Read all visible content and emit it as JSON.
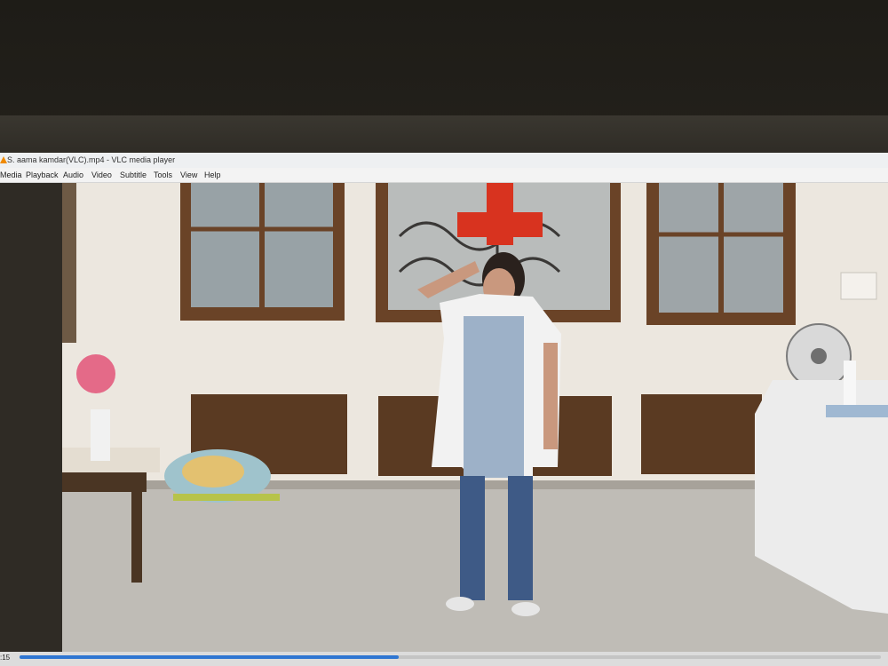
{
  "window": {
    "title": "S. aama kamdar(VLC).mp4 - VLC media player"
  },
  "menu": {
    "items": [
      "Media",
      "Playback",
      "Audio",
      "Video",
      "Subtitle",
      "Tools",
      "View",
      "Help"
    ]
  },
  "player": {
    "elapsed_time": ":15",
    "progress_fraction": 0.44
  },
  "icons": {
    "app_icon": "vlc-cone-icon"
  },
  "colors": {
    "seek_fill": "#2f76d2",
    "red_cross": "#d8331f"
  }
}
